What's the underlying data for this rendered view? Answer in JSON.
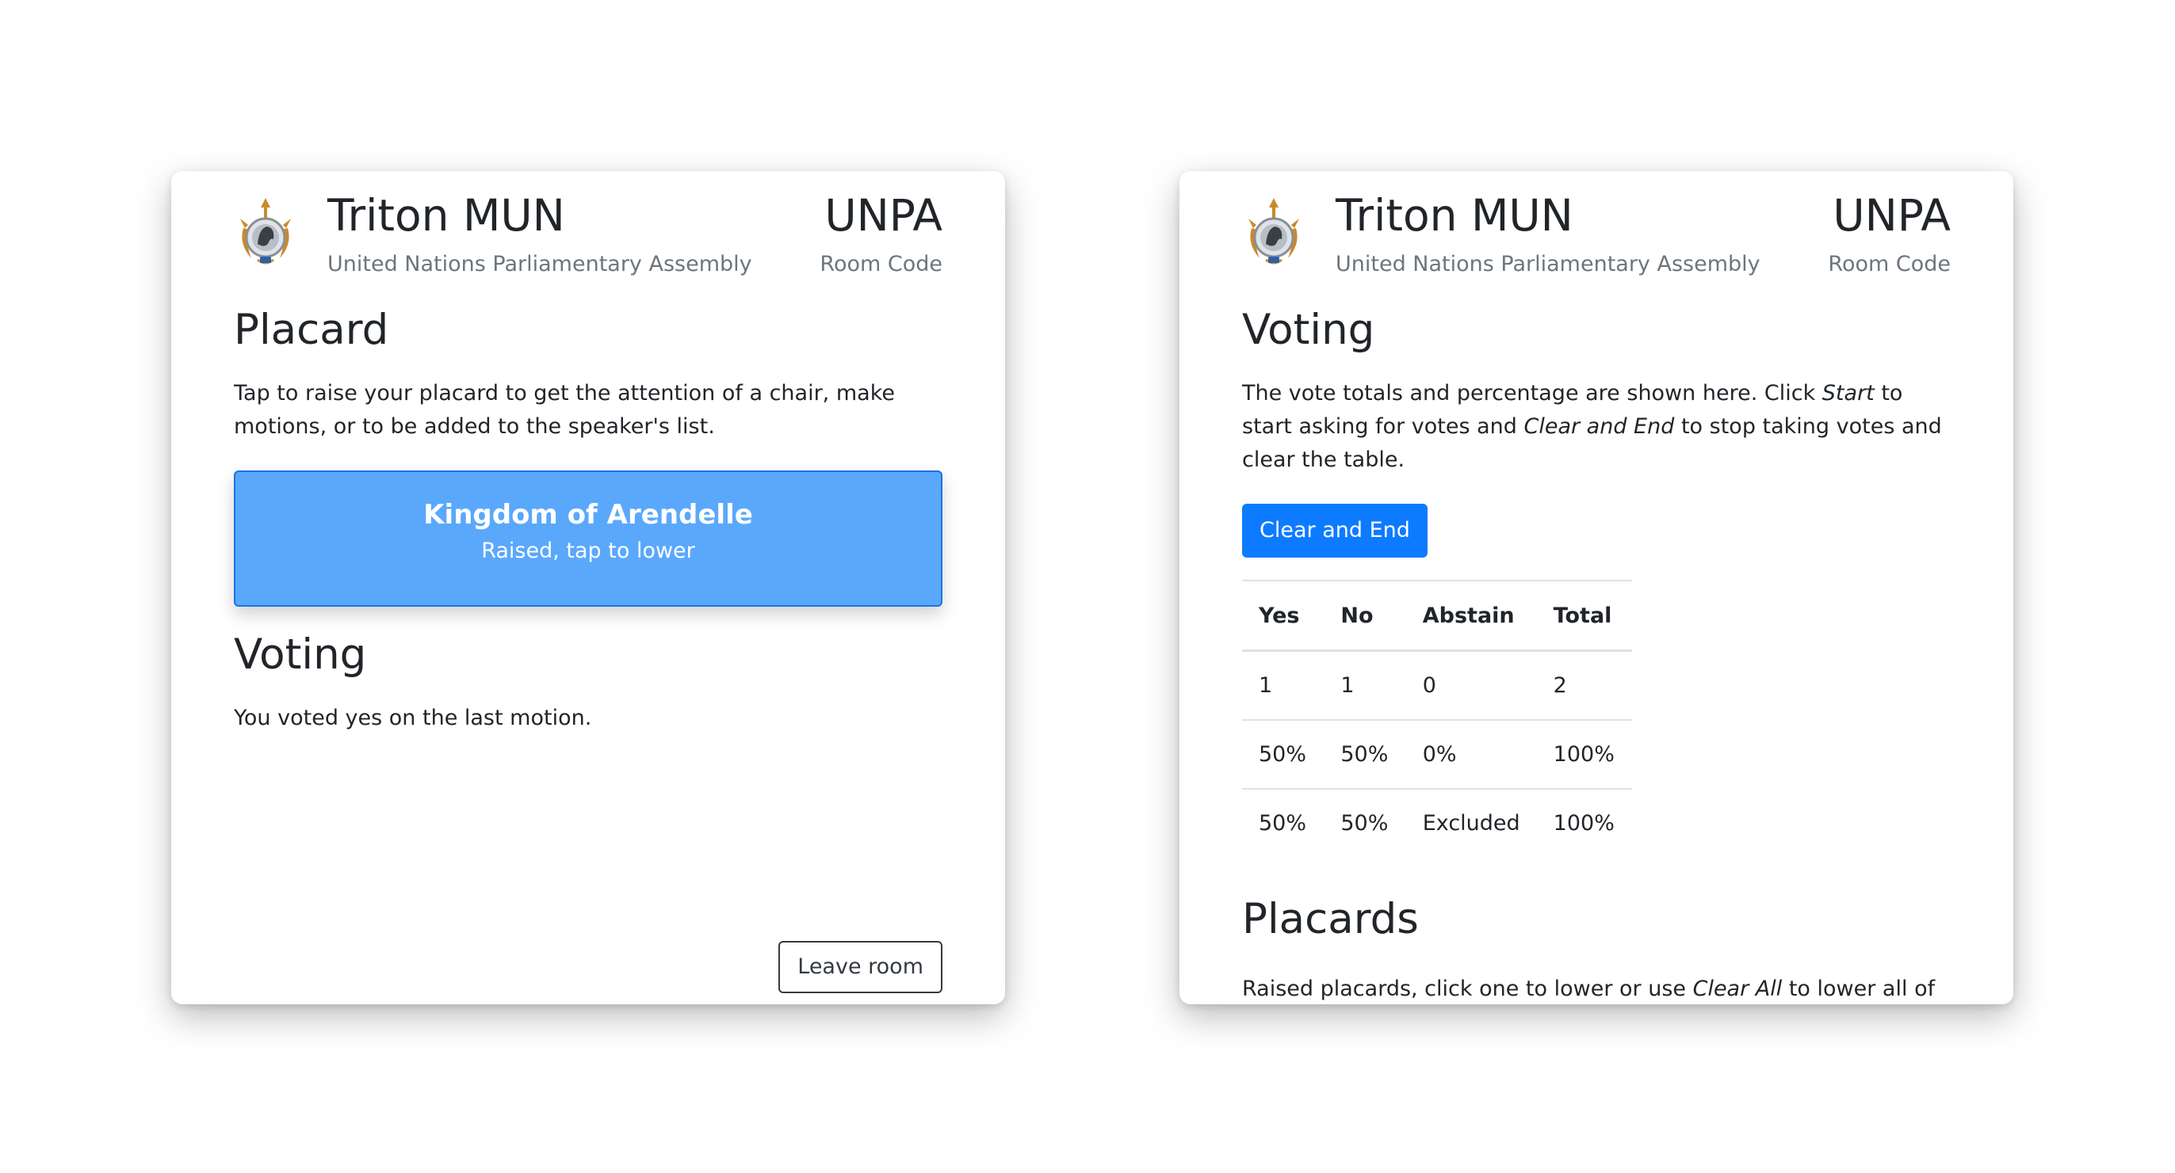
{
  "app": {
    "title": "Triton MUN",
    "subtitle": "United Nations Parliamentary Assembly",
    "room_name": "UNPA",
    "room_label": "Room Code"
  },
  "participant": {
    "placard_heading": "Placard",
    "placard_description": "Tap to raise your placard to get the attention of a chair, make motions, or to be added to the speaker's list.",
    "placard_button": {
      "country": "Kingdom of Arendelle",
      "status": "Raised, tap to lower"
    },
    "voting_heading": "Voting",
    "voting_status": "You voted yes on the last motion.",
    "leave_label": "Leave room"
  },
  "chair": {
    "voting_heading": "Voting",
    "voting_description": {
      "part1": "The vote totals and percentage are shown here. Click ",
      "em1": "Start",
      "part2": " to start asking for votes and ",
      "em2": "Clear and End",
      "part3": " to stop taking votes and clear the table."
    },
    "clear_button_label": "Clear and End",
    "table": {
      "headers": [
        "Yes",
        "No",
        "Abstain",
        "Total"
      ],
      "rows": [
        [
          "1",
          "1",
          "0",
          "2"
        ],
        [
          "50%",
          "50%",
          "0%",
          "100%"
        ],
        [
          "50%",
          "50%",
          "Excluded",
          "100%"
        ]
      ]
    },
    "placards_heading": "Placards",
    "placards_description": {
      "part1": "Raised placards, click one to lower or use ",
      "em1": "Clear All",
      "part2": " to lower all of them"
    }
  },
  "colors": {
    "placard_raised": "#5aa8fb",
    "primary_button": "#0d7bff",
    "logo_gold": "#c98a2a"
  },
  "icons": {
    "logo": "triton-mun-logo"
  }
}
